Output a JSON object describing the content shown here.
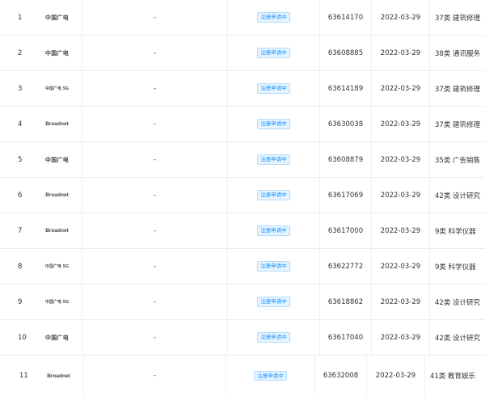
{
  "rows": [
    {
      "no": "1",
      "logo": "中国广电",
      "logo_style": "cn",
      "name": "-",
      "status": "注册申请中",
      "reg_no": "63614170",
      "date": "2022-03-29",
      "class": "37类 建筑修理"
    },
    {
      "no": "2",
      "logo": "中国广电",
      "logo_style": "cn",
      "name": "-",
      "status": "注册申请中",
      "reg_no": "63608885",
      "date": "2022-03-29",
      "class": "38类 通讯服务"
    },
    {
      "no": "3",
      "logo": "中国广电 5G",
      "logo_style": "5g",
      "name": "-",
      "status": "注册申请中",
      "reg_no": "63614189",
      "date": "2022-03-29",
      "class": "37类 建筑修理"
    },
    {
      "no": "4",
      "logo": "Broadnet",
      "logo_style": "en",
      "name": "-",
      "status": "注册申请中",
      "reg_no": "63630038",
      "date": "2022-03-29",
      "class": "37类 建筑修理"
    },
    {
      "no": "5",
      "logo": "中国广电",
      "logo_style": "cn",
      "name": "-",
      "status": "注册申请中",
      "reg_no": "63608879",
      "date": "2022-03-29",
      "class": "35类 广告销售"
    },
    {
      "no": "6",
      "logo": "Broadnet",
      "logo_style": "en",
      "name": "-",
      "status": "注册申请中",
      "reg_no": "63617069",
      "date": "2022-03-29",
      "class": "42类 设计研究"
    },
    {
      "no": "7",
      "logo": "Broadnet",
      "logo_style": "en",
      "name": "-",
      "status": "注册申请中",
      "reg_no": "63617000",
      "date": "2022-03-29",
      "class": "9类 科学仪器"
    },
    {
      "no": "8",
      "logo": "中国广电 5G",
      "logo_style": "5g",
      "name": "-",
      "status": "注册申请中",
      "reg_no": "63622772",
      "date": "2022-03-29",
      "class": "9类 科学仪器"
    },
    {
      "no": "9",
      "logo": "中国广电 5G",
      "logo_style": "5g",
      "name": "-",
      "status": "注册申请中",
      "reg_no": "63618862",
      "date": "2022-03-29",
      "class": "42类 设计研究"
    },
    {
      "no": "10",
      "logo": "中国广电",
      "logo_style": "cn",
      "name": "-",
      "status": "注册申请中",
      "reg_no": "63617040",
      "date": "2022-03-29",
      "class": "42类 设计研究"
    },
    {
      "no": "11",
      "logo": "Broadnet",
      "logo_style": "en",
      "name": "-",
      "status": "注册申请中",
      "reg_no": "63632008",
      "date": "2022-03-29",
      "class": "41类 教育娱乐"
    }
  ],
  "colors": {
    "badge_text": "#1890ff",
    "badge_bg": "#e6f4ff",
    "divider": "#e9edf2"
  }
}
